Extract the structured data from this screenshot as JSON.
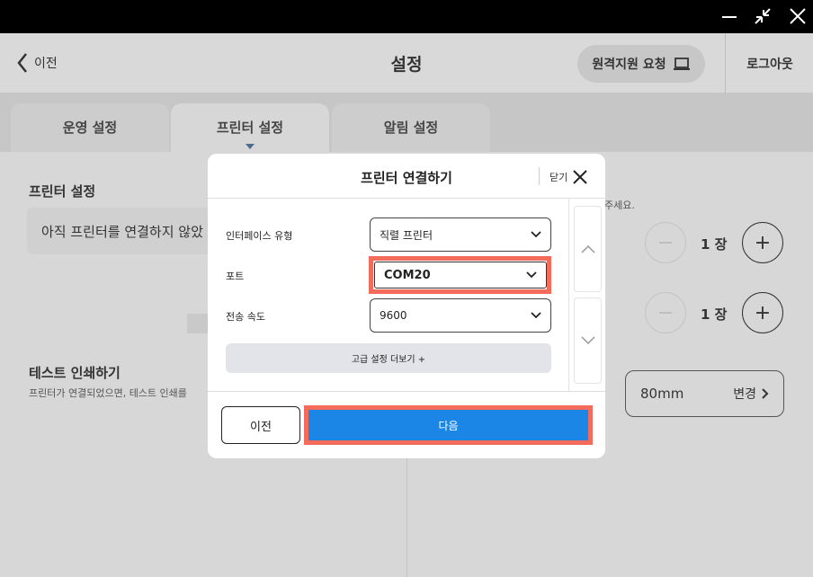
{
  "window": {
    "minimize_icon": "minimize-icon",
    "restore_icon": "restore-icon",
    "close_icon": "close-icon"
  },
  "header": {
    "back_label": "이전",
    "title": "설정",
    "remote_support_label": "원격지원 요청",
    "logout_label": "로그아웃"
  },
  "tabs": [
    {
      "label": "운영 설정",
      "active": false
    },
    {
      "label": "프린터 설정",
      "active": true
    },
    {
      "label": "알림 설정",
      "active": false
    }
  ],
  "background": {
    "section_title": "프린터 설정",
    "notice": "아직 프린터를 연결하지 않았",
    "test_title": "테스트 인쇄하기",
    "test_desc": "프린터가 연결되었으면, 테스트 인쇄를",
    "right_hint": "주세요.",
    "counter1_value": "1 장",
    "counter2_value": "1 장",
    "paper_size": "80mm",
    "change_label": "변경"
  },
  "modal": {
    "title": "프린터 연결하기",
    "close_label": "닫기",
    "fields": {
      "interface_label": "인터페이스 유형",
      "interface_value": "직렬 프린터",
      "port_label": "포트",
      "port_value": "COM20",
      "speed_label": "전송 속도",
      "speed_value": "9600"
    },
    "advanced_label": "고급 설정 더보기 +",
    "prev_label": "이전",
    "next_label": "다음"
  },
  "colors": {
    "highlight": "#f26b5b",
    "primary": "#1b86e6"
  }
}
